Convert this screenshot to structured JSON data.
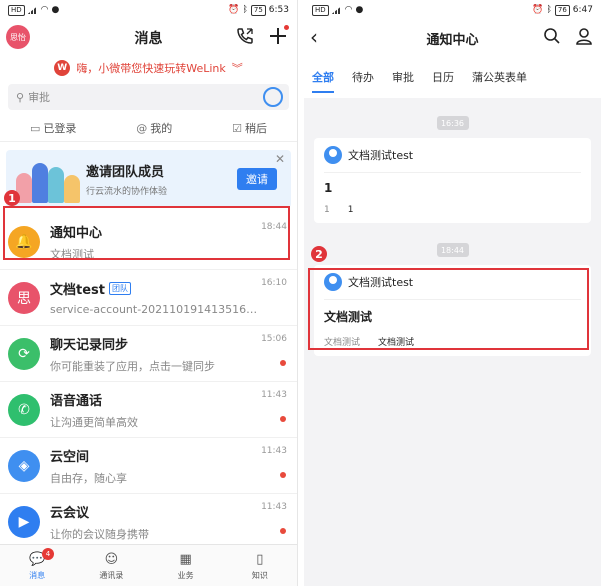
{
  "left": {
    "status": {
      "time": "6:53",
      "battery": "75"
    },
    "header": {
      "avatar_label": "思怡",
      "title": "消息"
    },
    "promo": {
      "text": "嗨，小微带您快速玩转WeLink",
      "logo": "W"
    },
    "search": {
      "placeholder": "审批"
    },
    "filters": [
      {
        "icon": "monitor-icon",
        "label": "已登录"
      },
      {
        "icon": "at-icon",
        "label": "我的"
      },
      {
        "icon": "checkbox-icon",
        "label": "稍后"
      }
    ],
    "invite": {
      "title": "邀请团队成员",
      "subtitle": "行云流水的协作体验",
      "button": "邀请"
    },
    "conversations": [
      {
        "name": "通知中心",
        "sub": "文档测试",
        "time": "18:44",
        "color": "#f5a623",
        "icon": "bell-icon",
        "glyph": "🔔",
        "unread": false
      },
      {
        "name": "文档test",
        "tag": "团队",
        "sub": "service-account-20211019141351699...",
        "time": "16:10",
        "color": "#e8536a",
        "icon": "group-avatar-icon",
        "glyph": "思",
        "unread": false
      },
      {
        "name": "聊天记录同步",
        "sub": "你可能重装了应用，点击一键同步",
        "time": "15:06",
        "color": "#3bbf6a",
        "icon": "sync-icon",
        "glyph": "⟳",
        "unread": true
      },
      {
        "name": "语音通话",
        "sub": "让沟通更简单高效",
        "time": "11:43",
        "color": "#2fbf6e",
        "icon": "phone-icon",
        "glyph": "✆",
        "unread": true
      },
      {
        "name": "云空间",
        "sub": "自由存，随心享",
        "time": "11:43",
        "color": "#3f8ff0",
        "icon": "cloud-box-icon",
        "glyph": "◈",
        "unread": true
      },
      {
        "name": "云会议",
        "sub": "让你的会议随身携带",
        "time": "11:43",
        "color": "#2f7ef0",
        "icon": "video-icon",
        "glyph": "▶",
        "unread": true
      }
    ],
    "tabs": [
      {
        "label": "消息",
        "badge": "4",
        "glyph": "💬"
      },
      {
        "label": "通讯录",
        "glyph": "☺"
      },
      {
        "label": "业务",
        "glyph": "▦"
      },
      {
        "label": "知识",
        "glyph": "▯"
      }
    ],
    "marker": "1"
  },
  "right": {
    "status": {
      "time": "6:47",
      "battery": "76"
    },
    "header": {
      "title": "通知中心"
    },
    "tabs": [
      "全部",
      "待办",
      "审批",
      "日历",
      "蒲公英表单"
    ],
    "groups": [
      {
        "time": "16:36",
        "card": {
          "sender": "文档测试test",
          "title": "1",
          "key": "1",
          "value": "1"
        }
      },
      {
        "time": "18:44",
        "card": {
          "sender": "文档测试test",
          "title": "文档测试",
          "key": "文档测试",
          "value": "文档测试"
        }
      }
    ],
    "marker": "2"
  },
  "colors": {
    "accent": "#2f7ef0",
    "highlight": "#e0343a"
  }
}
